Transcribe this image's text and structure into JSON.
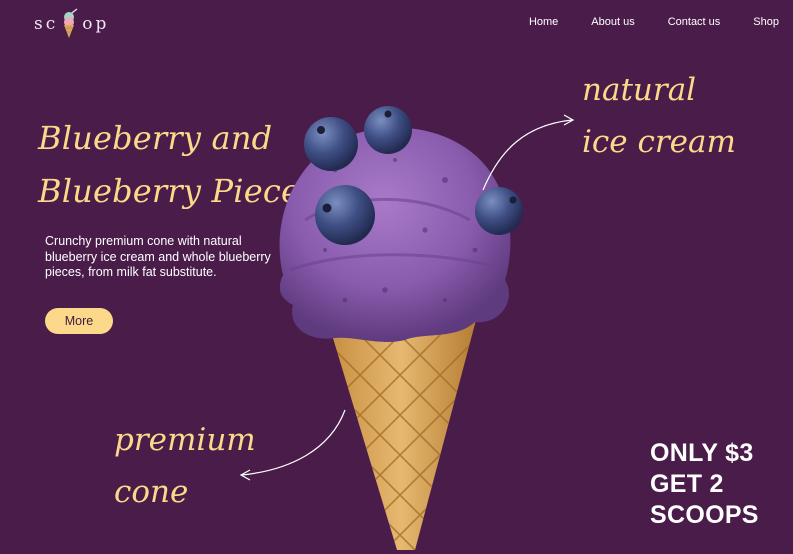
{
  "logo": {
    "letters_before": "sc",
    "letters_after": "op",
    "icon": "ice-cream-cone-icon"
  },
  "nav": {
    "items": [
      {
        "label": "Home"
      },
      {
        "label": "About us"
      },
      {
        "label": "Contact us"
      },
      {
        "label": "Shop"
      }
    ]
  },
  "hero": {
    "title_line1": "Blueberry and",
    "title_line2": "Blueberry Pieces",
    "description": "Crunchy premium cone with natural blueberry ice cream and whole blueberry pieces, from milk fat substitute.",
    "more_label": "More",
    "image": "blueberry-ice-cream-cone-photo"
  },
  "callouts": {
    "natural_line1": "natural",
    "natural_line2": "ice cream",
    "premium_line1": "premium",
    "premium_line2": "cone"
  },
  "offer": {
    "line1": "ONLY $3",
    "line2": "GET 2",
    "line3": "SCOOPS"
  },
  "colors": {
    "background": "#4a1c4a",
    "accent": "#fcd98a",
    "text": "#ffffff",
    "ice_cream": "#8a5cae",
    "blueberry": "#3a4a7a",
    "cone": "#d9a85c"
  }
}
